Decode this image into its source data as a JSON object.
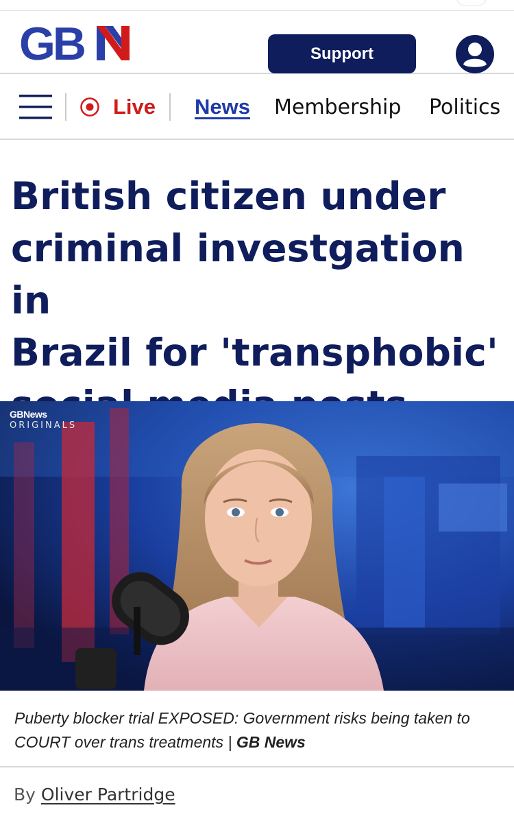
{
  "header": {
    "logo_text": "GBN",
    "support_label": "Support",
    "account_icon": "user-circle-icon"
  },
  "nav": {
    "menu_icon": "hamburger-icon",
    "live_icon": "live-dot-icon",
    "live_label": "Live",
    "items": [
      {
        "label": "News"
      },
      {
        "label": "Membership"
      },
      {
        "label": "Politics"
      }
    ]
  },
  "article": {
    "headline_lines": [
      "British citizen under",
      "criminal investgation in",
      "Brazil for 'transphobic'",
      "social media posts"
    ],
    "video_badge_brand": "GBNews",
    "video_badge_sub": "ORIGINALS",
    "caption_text": "Puberty blocker trial EXPOSED: Government risks being taken to COURT over trans treatments | ",
    "caption_source": "GB News",
    "byline_prefix": "By",
    "author": "Oliver Partridge"
  },
  "colors": {
    "brand_navy": "#0f1d5c",
    "brand_blue": "#2b3fa8",
    "brand_red": "#d11a1a"
  }
}
